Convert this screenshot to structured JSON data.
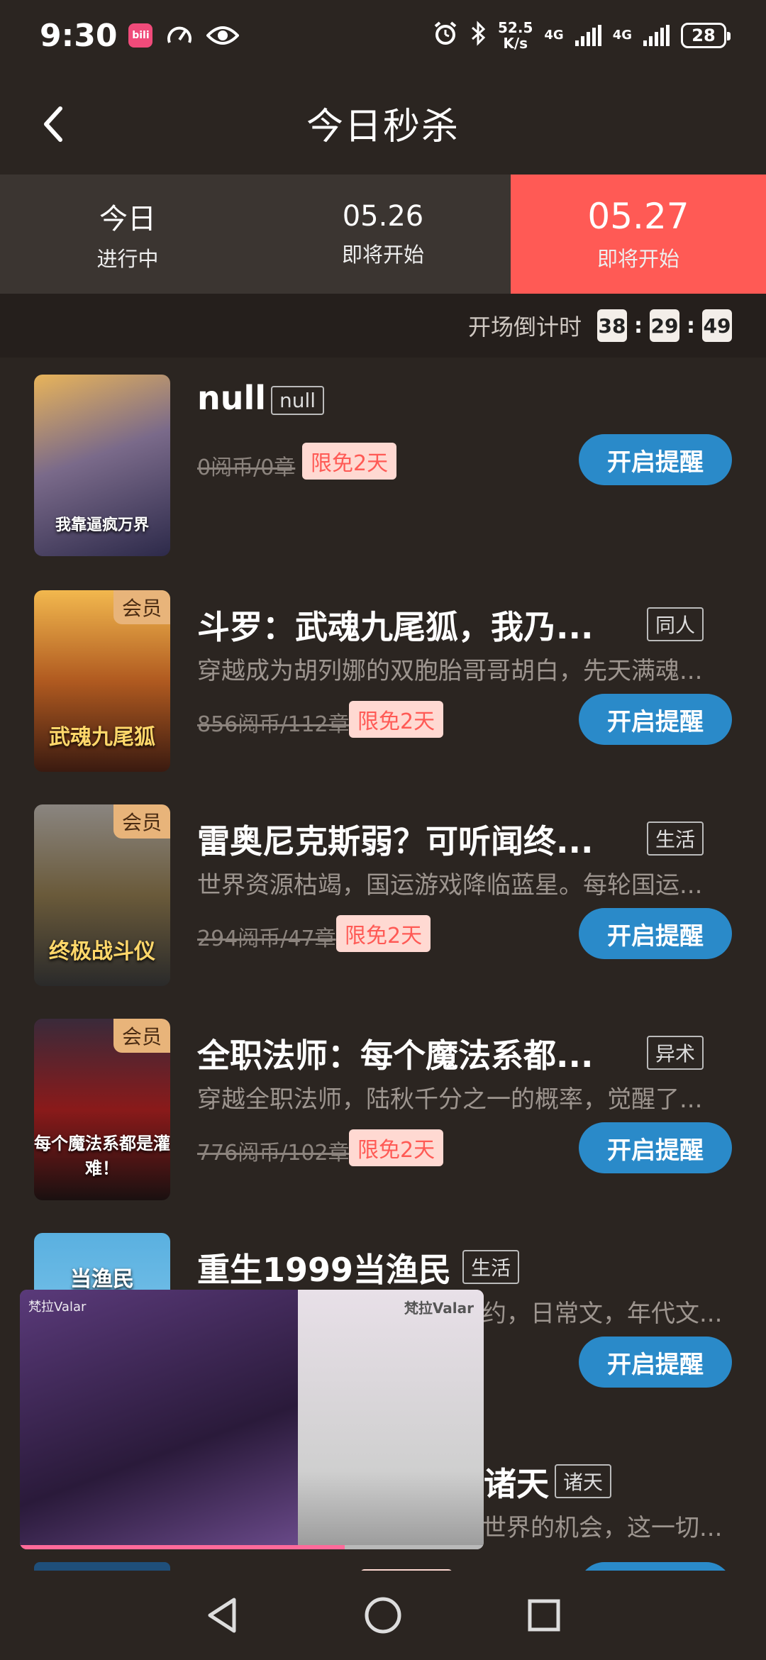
{
  "status_bar": {
    "time": "9:30",
    "speed_value": "52.5",
    "speed_unit": "K/s",
    "net1": "4G",
    "net2": "4G",
    "battery": "28"
  },
  "header": {
    "title": "今日秒杀"
  },
  "tabs": [
    {
      "line1": "今日",
      "line2": "进行中"
    },
    {
      "line1": "05.26",
      "line2": "即将开始"
    },
    {
      "line1": "05.27",
      "line2": "即将开始"
    }
  ],
  "countdown": {
    "label": "开场倒计时",
    "hours": "38",
    "minutes": "29",
    "seconds": "49",
    "separator": ":"
  },
  "books": [
    {
      "title": "null",
      "genre": "null",
      "desc": "",
      "price": "0阅币/0章",
      "free": "限免2天",
      "button": "开启提醒",
      "vip": "",
      "cover_text": "我靠逼疯万界"
    },
    {
      "title": "斗罗：武魂九尾狐，我乃...",
      "genre": "同人",
      "desc": "穿越成为胡列娜的双胞胎哥哥胡白，先天满魂...",
      "price": "856阅币/112章",
      "free": "限免2天",
      "button": "开启提醒",
      "vip": "会员",
      "cover_text": "武魂九尾狐"
    },
    {
      "title": "雷奥尼克斯弱？可听闻终...",
      "genre": "生活",
      "desc": "世界资源枯竭，国运游戏降临蓝星。每轮国运...",
      "price": "294阅币/47章",
      "free": "限免2天",
      "button": "开启提醒",
      "vip": "会员",
      "cover_text": "终极战斗仪"
    },
    {
      "title": "全职法师：每个魔法系都...",
      "genre": "异术",
      "desc": "穿越全职法师，陆秋千分之一的概率，觉醒了...",
      "price": "776阅币/102章",
      "free": "限免2天",
      "button": "开启提醒",
      "vip": "会员",
      "cover_text": "每个魔法系都是灌难！"
    },
    {
      "title": "重生1999当渔民",
      "genre": "生活",
      "desc": "约，日常文，年代文...",
      "price": "",
      "free": "",
      "button": "开启提醒",
      "vip": "",
      "cover_text": "当渔民"
    },
    {
      "title": "诸天",
      "genre": "诸天",
      "desc": "世界的机会，这一切...",
      "price": "",
      "free": "",
      "button": "",
      "vip": "",
      "cover_text": ""
    }
  ],
  "video": {
    "watermark_left": "梵拉Valar",
    "watermark_right": "梵拉Valar",
    "progress": 0.7
  },
  "colors": {
    "accent": "#ff5a55",
    "button": "#2a8ac9",
    "background": "#2b2521"
  }
}
